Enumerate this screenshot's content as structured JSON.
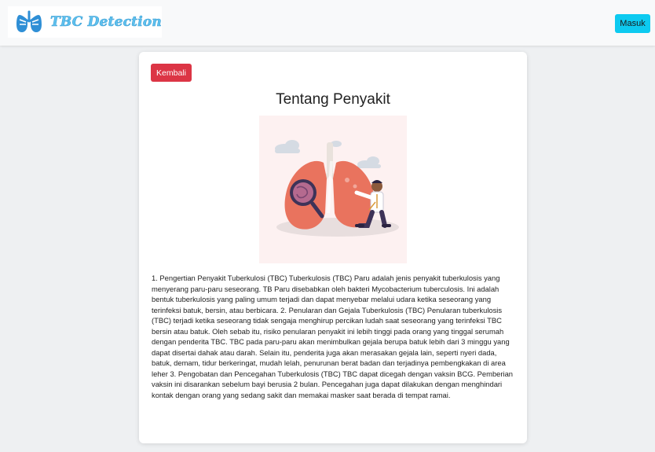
{
  "navbar": {
    "brand_text": "TBC Detection",
    "login_label": "Masuk",
    "login_color": "#0dcaf0"
  },
  "card": {
    "back_label": "Kembali",
    "back_color": "#dc3545",
    "title": "Tentang Penyakit",
    "illustration_icon": "lungs-doctor-illustration",
    "body_text": "1. Pengertian Penyakit Tuberkulosi (TBC) Tuberkulosis (TBC) Paru adalah jenis penyakit tuberkulosis yang menyerang paru-paru seseorang. TB Paru disebabkan oleh bakteri Mycobacterium tuberculosis. Ini adalah bentuk tuberkulosis yang paling umum terjadi dan dapat menyebar melalui udara ketika seseorang yang terinfeksi batuk, bersin, atau berbicara. 2. Penularan dan Gejala Tuberkulosis (TBC) Penularan tuberkulosis (TBC) terjadi ketika seseorang tidak sengaja menghirup percikan ludah saat seseorang yang terinfeksi TBC bersin atau batuk. Oleh sebab itu, risiko penularan penyakit ini lebih tinggi pada orang yang tinggal serumah dengan penderita TBC. TBC pada paru-paru akan menimbulkan gejala berupa batuk lebih dari 3 minggu yang dapat disertai dahak atau darah. Selain itu, penderita juga akan merasakan gejala lain, seperti nyeri dada, batuk, demam, tidur berkeringat, mudah lelah, penurunan berat badan dan terjadinya pembengkakan di area leher 3. Pengobatan dan Pencegahan Tuberkulosis (TBC) TBC dapat dicegah dengan vaksin BCG. Pemberian vaksin ini disarankan sebelum bayi berusia 2 bulan. Pencegahan juga dapat dilakukan dengan menghindari kontak dengan orang yang sedang sakit dan memakai masker saat berada di tempat ramai."
  }
}
